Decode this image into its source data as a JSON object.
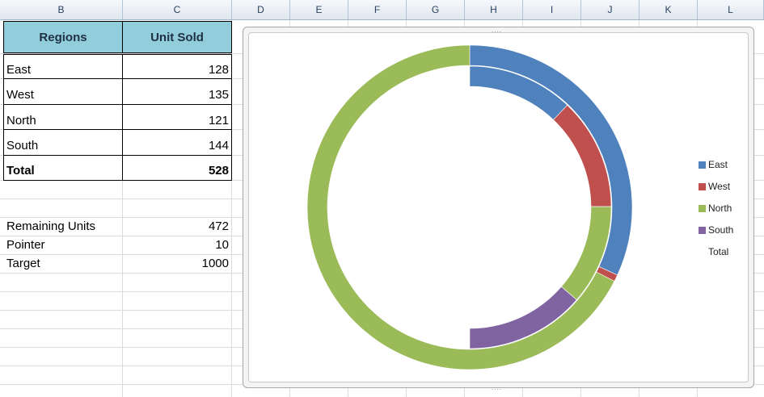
{
  "columns": [
    "B",
    "C",
    "D",
    "E",
    "F",
    "G",
    "H",
    "I",
    "J",
    "K",
    "L"
  ],
  "table": {
    "headers": [
      "Regions",
      "Unit Sold"
    ],
    "rows": [
      {
        "label": "East",
        "value": "128"
      },
      {
        "label": "West",
        "value": "135"
      },
      {
        "label": "North",
        "value": "121"
      },
      {
        "label": "South",
        "value": "144"
      }
    ],
    "total": {
      "label": "Total",
      "value": "528"
    }
  },
  "stats": [
    {
      "label": "Remaining Units",
      "value": "472"
    },
    {
      "label": "Pointer",
      "value": "10"
    },
    {
      "label": "Target",
      "value": "1000"
    }
  ],
  "chart_data": {
    "type": "doughnut",
    "rings": [
      {
        "name": "inner",
        "values": [
          128,
          135,
          121,
          144,
          528
        ]
      },
      {
        "name": "outer",
        "values": [
          472,
          10,
          1000
        ]
      }
    ],
    "legend": [
      "East",
      "West",
      "North",
      "South",
      "Total"
    ],
    "legend_position": "right",
    "colors": {
      "East": "#4f81bd",
      "West": "#c0504d",
      "North": "#9bbb59",
      "South": "#8064a2"
    }
  }
}
